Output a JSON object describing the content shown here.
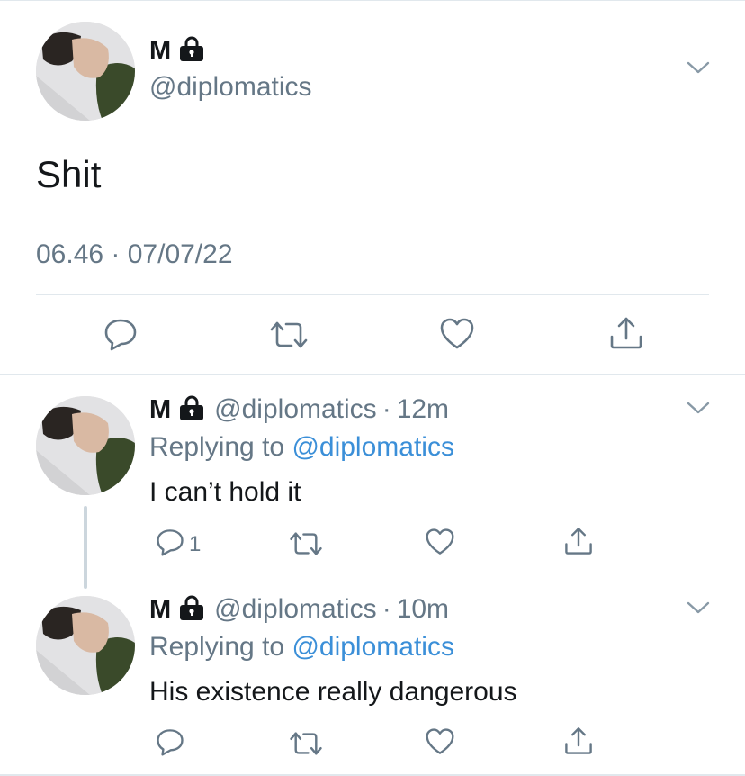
{
  "main_tweet": {
    "name": "M",
    "handle": "@diplomatics",
    "text": "Shit",
    "timestamp": "06.46 · 07/07/22",
    "icons": [
      "reply-icon",
      "retweet-icon",
      "like-icon",
      "share-icon"
    ]
  },
  "replies": [
    {
      "name": "M",
      "handle": "@diplomatics",
      "dot": "·",
      "ago": "12m",
      "replying_prefix": "Replying to ",
      "replying_to": "@diplomatics",
      "text": "I can’t hold it",
      "reply_count": "1"
    },
    {
      "name": "M",
      "handle": "@diplomatics",
      "dot": "·",
      "ago": "10m",
      "replying_prefix": "Replying to ",
      "replying_to": "@diplomatics",
      "text": "His existence really dangerous",
      "reply_count": ""
    }
  ],
  "colors": {
    "primary_text": "#14171a",
    "secondary_text": "#657786",
    "link": "#3b8fd8",
    "divider": "#e1e8ed"
  }
}
